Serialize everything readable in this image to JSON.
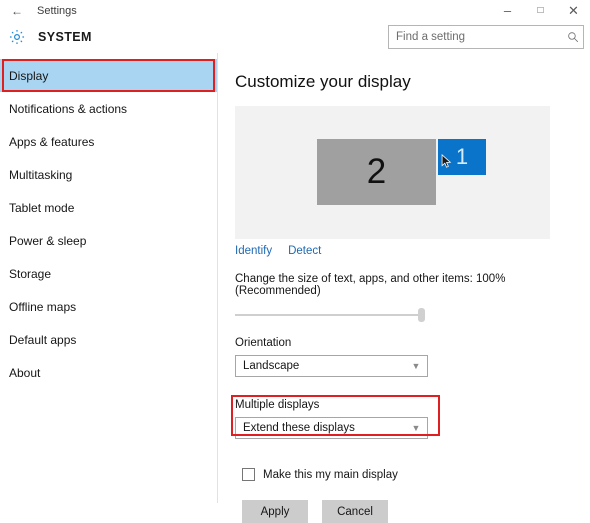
{
  "window": {
    "title": "Settings",
    "back_icon": "back-arrow-icon",
    "controls": {
      "minimize": "–",
      "maximize": "□",
      "close": "✕"
    }
  },
  "header": {
    "icon": "gear-icon",
    "title": "SYSTEM",
    "search_placeholder": "Find a setting",
    "search_value": "",
    "search_icon": "search-icon"
  },
  "sidebar": {
    "items": [
      {
        "label": "Display",
        "selected": true,
        "annotated": true
      },
      {
        "label": "Notifications & actions",
        "selected": false,
        "annotated": false
      },
      {
        "label": "Apps & features",
        "selected": false,
        "annotated": false
      },
      {
        "label": "Multitasking",
        "selected": false,
        "annotated": false
      },
      {
        "label": "Tablet mode",
        "selected": false,
        "annotated": false
      },
      {
        "label": "Power & sleep",
        "selected": false,
        "annotated": false
      },
      {
        "label": "Storage",
        "selected": false,
        "annotated": false
      },
      {
        "label": "Offline maps",
        "selected": false,
        "annotated": false
      },
      {
        "label": "Default apps",
        "selected": false,
        "annotated": false
      },
      {
        "label": "About",
        "selected": false,
        "annotated": false
      }
    ]
  },
  "main": {
    "page_title": "Customize your display",
    "monitors": [
      {
        "number": "2",
        "selected": false
      },
      {
        "number": "1",
        "selected": true
      }
    ],
    "cursor_icon": "mouse-pointer-icon",
    "identify_link": "Identify",
    "detect_link": "Detect",
    "scale_label": "Change the size of text, apps, and other items: 100% (Recommended)",
    "scale_percent": 100,
    "orientation_label": "Orientation",
    "orientation_value": "Landscape",
    "multiple_displays_label": "Multiple displays",
    "multiple_displays_value": "Extend these displays",
    "main_display_checkbox_label": "Make this my main display",
    "main_display_checked": false,
    "apply_button": "Apply",
    "cancel_button": "Cancel",
    "chevron_icon": "chevron-down-icon"
  },
  "colors": {
    "accent": "#0a74cb",
    "selection": "#a9d5f2",
    "annotation": "#e02020",
    "link": "#1e69b4"
  }
}
